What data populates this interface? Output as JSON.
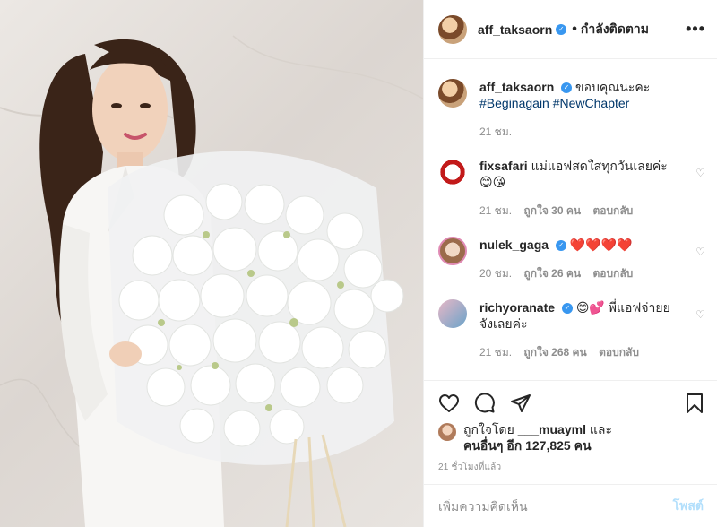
{
  "header": {
    "username": "aff_taksaorn",
    "verified": true,
    "separator": "•",
    "follow_label": "กำลังติดตาม",
    "more_label": "•••"
  },
  "caption": {
    "username": "aff_taksaorn",
    "text": "ขอบคุณนะคะ",
    "hashtags": "#Beginagain #NewChapter",
    "time": "21 ชม."
  },
  "comments": [
    {
      "username": "fixsafari",
      "text": "แม่แอฟสดใสทุกวันเลยค่ะ",
      "emoji": "😊😘",
      "time": "21 ชม.",
      "likes": "ถูกใจ 30 คน",
      "reply": "ตอบกลับ"
    },
    {
      "username": "nulek_gaga",
      "verified": true,
      "text": "",
      "emoji": "❤️❤️❤️❤️",
      "time": "20 ชม.",
      "likes": "ถูกใจ 26 คน",
      "reply": "ตอบกลับ"
    },
    {
      "username": "richyoranate",
      "verified": true,
      "text": "😊💕 พี่แอฟจ่ายย",
      "text2": "จังเลยค่ะ",
      "time": "21 ชม.",
      "likes": "ถูกใจ 268 คน",
      "reply": "ตอบกลับ"
    }
  ],
  "likes": {
    "prefix": "ถูกใจโดย",
    "user": "___muayml",
    "and": "และ",
    "others": "คนอื่นๆ อีก 127,825 คน"
  },
  "posted_time": "21 ชั่วโมงที่แล้ว",
  "add_comment": {
    "placeholder": "เพิ่มความคิดเห็น",
    "post_label": "โพสต์"
  },
  "colors": {
    "link": "#00376b",
    "verified": "#3897f0",
    "muted": "#8e8e8e",
    "post_disabled": "#b2dffc"
  },
  "icons": [
    "heart-icon",
    "comment-icon",
    "share-icon",
    "bookmark-icon",
    "more-icon",
    "verified-icon"
  ]
}
